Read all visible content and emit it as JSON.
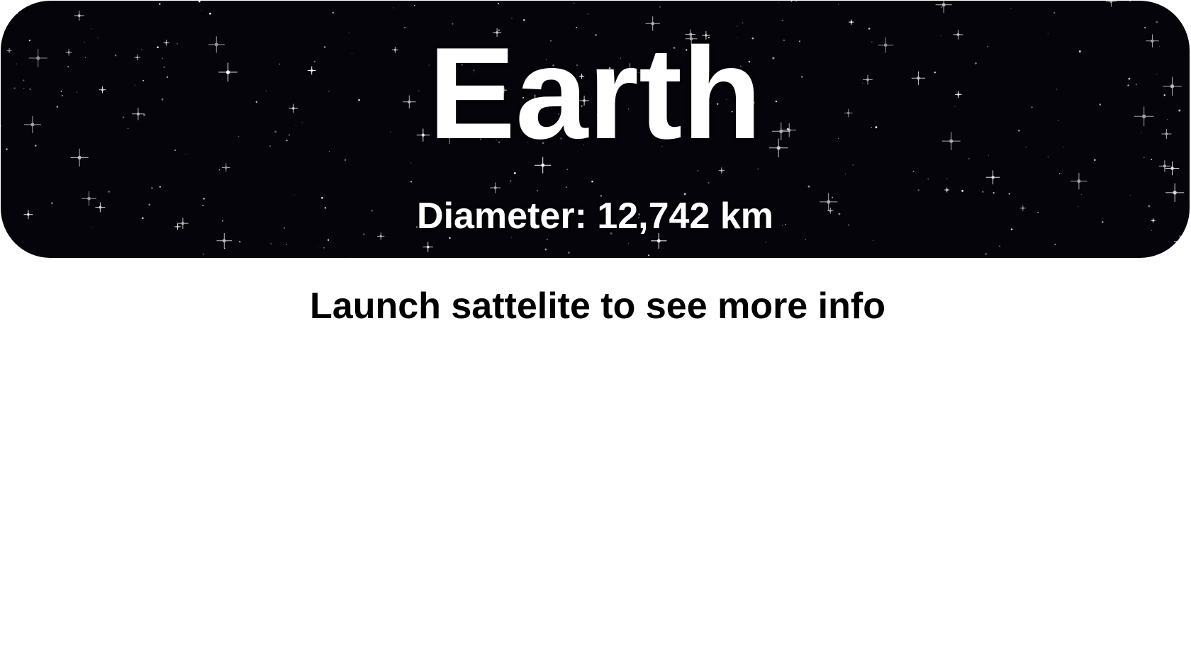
{
  "planet": {
    "name": "Earth",
    "diameter_text": "Diameter: 12,742 km"
  },
  "hint": {
    "text": "Launch sattelite to see more info"
  },
  "colors": {
    "banner_background": "#05040a",
    "star": "#ffffff",
    "title_text": "#ffffff",
    "hint_text": "#000000",
    "page_background": "#ffffff"
  },
  "banner": {
    "background_icon": "starfield-image"
  }
}
